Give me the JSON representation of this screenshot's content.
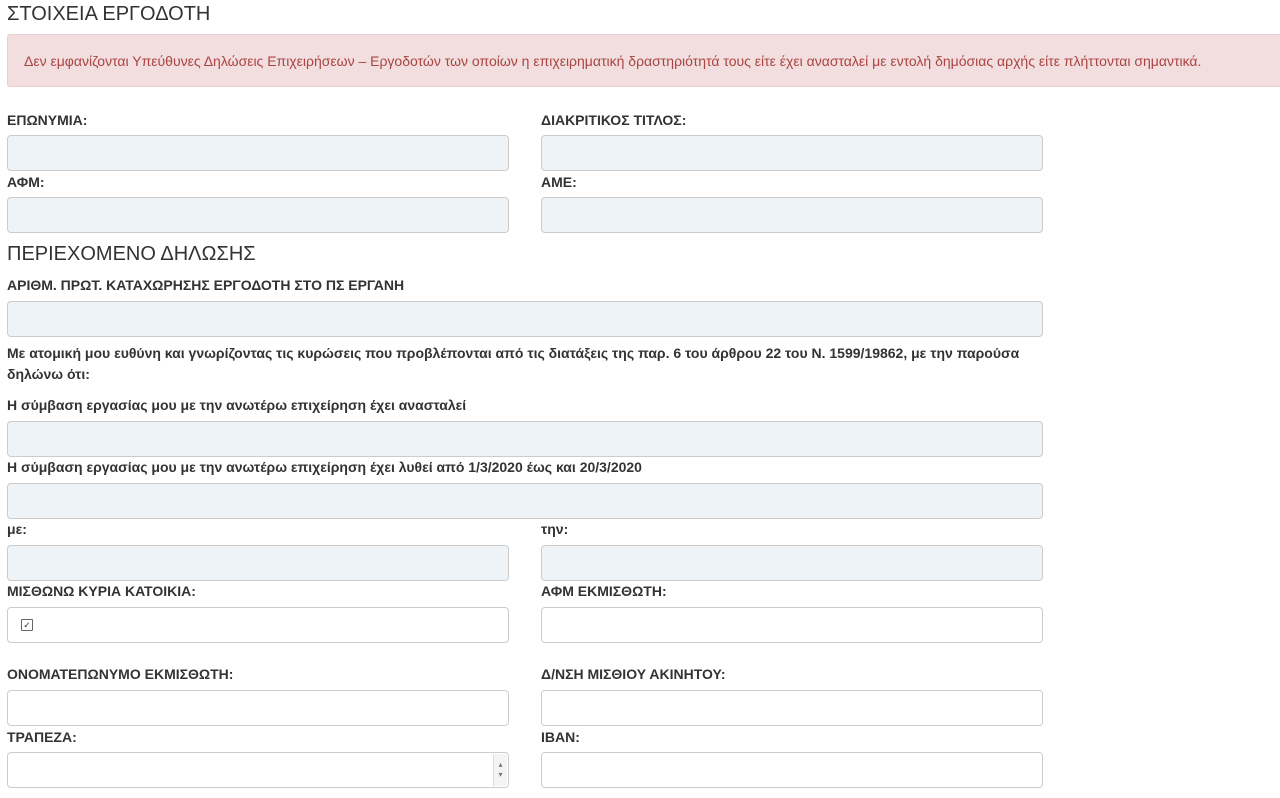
{
  "employer_section": {
    "title": "ΣΤΟΙΧΕΙΑ ΕΡΓΟΔΟΤΗ",
    "alert": "Δεν εμφανίζονται Υπεύθυνες Δηλώσεις Επιχειρήσεων – Εργοδοτών των οποίων η επιχειρηματική δραστηριότητά τους είτε έχει ανασταλεί με εντολή δημόσιας αρχής είτε πλήττονται σημαντικά.",
    "name_label": "ΕΠΩΝΥΜΙΑ:",
    "trade_name_label": "ΔΙΑΚΡΙΤΙΚΟΣ ΤΙΤΛΟΣ:",
    "afm_label": "ΑΦΜ:",
    "ame_label": "ΑΜΕ:"
  },
  "declaration_section": {
    "title": "ΠΕΡΙΕΧΟΜΕΝΟ ΔΗΛΩΣΗΣ",
    "protocol_label": "ΑΡΙΘΜ. ΠΡΩΤ. ΚΑΤΑΧΩΡΗΣΗΣ ΕΡΓΟΔΟΤΗ ΣΤΟ ΠΣ ΕΡΓΑΝΗ",
    "statement": "Με ατομική μου ευθύνη και γνωρίζοντας τις κυρώσεις που προβλέπονται από τις διατάξεις της παρ. 6 του άρθρου 22 του Ν. 1599/19862, με την παρούσα δηλώνω ότι:",
    "suspended_label": "Η σύμβαση εργασίας μου με την ανωτέρω επιχείρηση έχει ανασταλεί",
    "terminated_label": "Η σύμβαση εργασίας μου με την ανωτέρω επιχείρηση έχει λυθεί από 1/3/2020 έως και 20/3/2020",
    "with_label": "με:",
    "the_label": "την:",
    "rent_label": "ΜΙΣΘΩΝΩ ΚΥΡΙΑ ΚΑΤΟΙΚΙΑ:",
    "rent_checked": true,
    "landlord_afm_label": "ΑΦΜ ΕΚΜΙΣΘΩΤΗ:",
    "landlord_name_label": "ΟΝΟΜΑΤΕΠΩΝΥΜΟ ΕΚΜΙΣΘΩΤΗ:",
    "property_address_label": "Δ/ΝΣΗ ΜΙΣΘΙΟΥ ΑΚΙΝΗΤΟΥ:",
    "bank_label": "ΤΡΑΠΕΖΑ:",
    "bank_value": "",
    "iban_label": "IBAN:"
  },
  "icons": {
    "checkbox": "checkbox-checked-icon",
    "select_arrows": "chevron-up-down-icon"
  },
  "colors": {
    "alert_bg": "#f2dede",
    "alert_text": "#a94442",
    "readonly_field_bg": "#eef3f8"
  }
}
